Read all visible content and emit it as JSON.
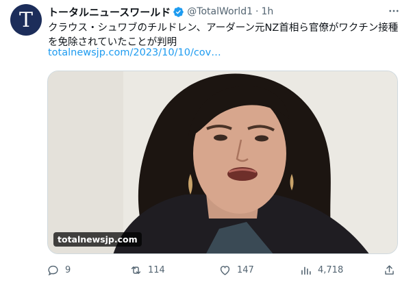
{
  "account": {
    "avatar_letter": "T",
    "display_name": "トータルニュースワールド",
    "handle": "@TotalWorld1",
    "separator": "·",
    "time": "1h",
    "avatar_color": "#1c2d5a",
    "verified_color": "#1d9bf0"
  },
  "tweet": {
    "text": "クラウス・シュワブのチルドレン、アーダーン元NZ首相ら官僚がワクチン接種を免除されていたことが判明",
    "link": "totalnewsjp.com/2023/10/10/cov…"
  },
  "media": {
    "label": "totalnewsjp.com"
  },
  "actions": {
    "reply": {
      "icon": "reply-icon",
      "count": "9"
    },
    "retweet": {
      "icon": "retweet-icon",
      "count": "114"
    },
    "like": {
      "icon": "heart-icon",
      "count": "147"
    },
    "views": {
      "icon": "views-icon",
      "count": "4,718"
    },
    "share": {
      "icon": "share-icon"
    }
  },
  "colors": {
    "text": "#0f1419",
    "secondary": "#536471",
    "link": "#1d9bf0"
  }
}
